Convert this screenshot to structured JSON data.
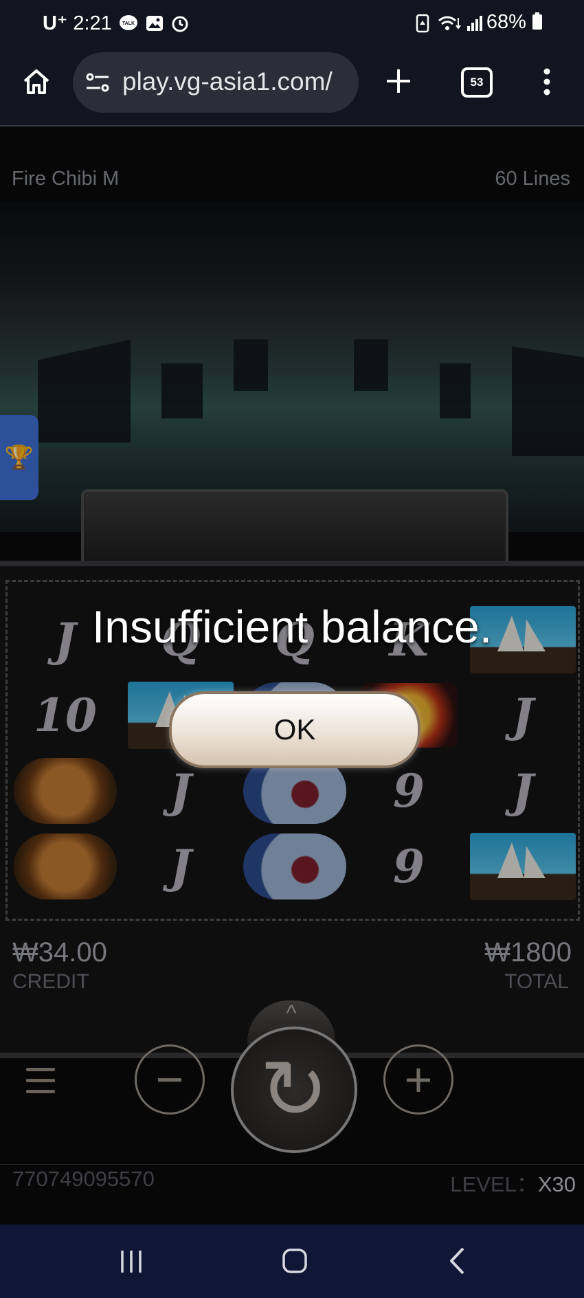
{
  "status_bar": {
    "carrier": "U⁺",
    "time": "2:21",
    "battery": "68%"
  },
  "browser": {
    "url": "play.vg-asia1.com/",
    "tab_count": "53"
  },
  "game": {
    "title": "Fire Chibi M",
    "lines": "60 Lines",
    "reels": [
      [
        "J",
        "10",
        "arrows",
        "arrows"
      ],
      [
        "Q",
        "ship",
        "J",
        "J"
      ],
      [
        "Q",
        "fan",
        "fan",
        "fan"
      ],
      [
        "K",
        "gold",
        "9",
        "9"
      ],
      [
        "ship",
        "J",
        "J",
        "ship"
      ]
    ],
    "credit_value": "₩34.00",
    "credit_label": "CREDIT",
    "total_value": "₩1800",
    "total_label": "TOTAL",
    "game_id": "770749095570",
    "level_label": "LEVEL：",
    "level_value": "X30"
  },
  "dialog": {
    "message": "Insufficient balance.",
    "ok_label": "OK"
  },
  "icons": {
    "minus": "−",
    "plus": "+",
    "spin": "↻",
    "spin_up": "^"
  }
}
